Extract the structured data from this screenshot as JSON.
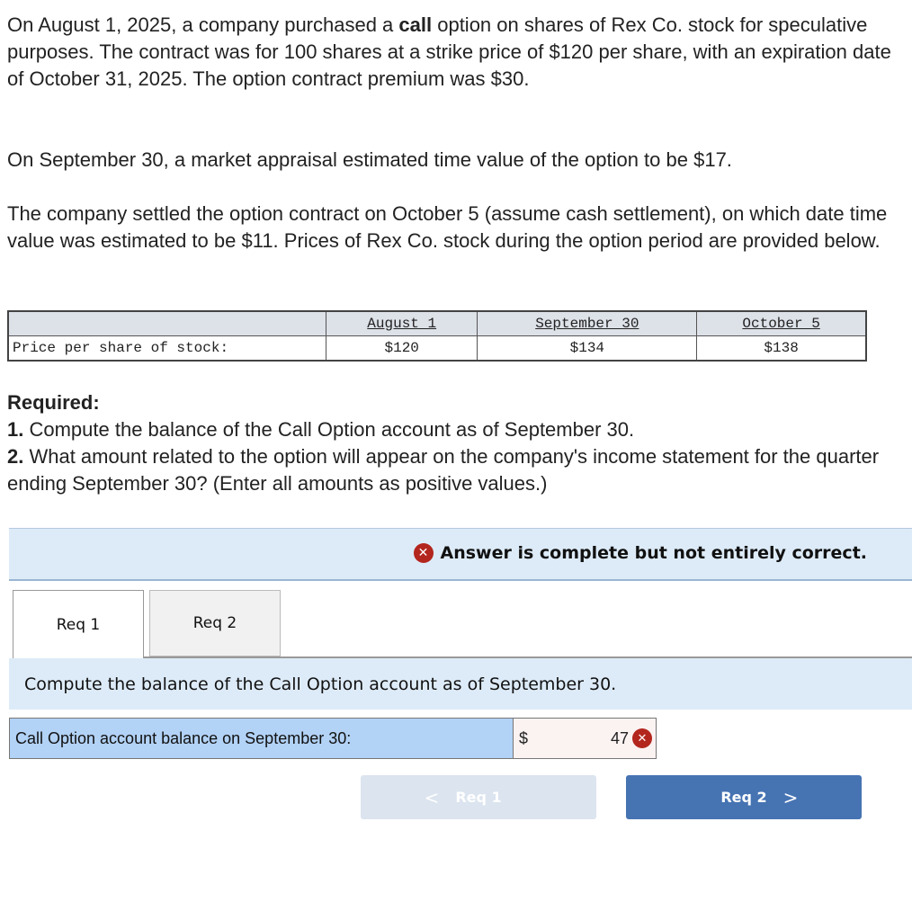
{
  "problem": {
    "intro_before_bold": "On August 1, 2025, a company purchased a ",
    "intro_bold": "call",
    "intro_after_bold": " option on shares of Rex Co. stock for speculative purposes.  The contract was for 100 shares at a strike price of $120 per share, with an expiration date of October 31, 2025.  The option contract premium was $30.",
    "appraisal": "On September 30, a market appraisal estimated time value of the option to be $17.",
    "settlement": "The company settled the option contract on October 5 (assume cash settlement), on which date time value was estimated to be $11.  Prices of Rex Co. stock during the option period are provided below."
  },
  "price_table": {
    "columns": [
      "",
      "August 1",
      "September 30",
      "October 5"
    ],
    "rows": [
      {
        "label": "Price per share of stock:",
        "values": [
          "$120",
          "$134",
          "$138"
        ]
      }
    ]
  },
  "required": {
    "title": "Required:",
    "items": [
      {
        "num": "1.",
        "text": " Compute the balance of the Call Option account as of September 30."
      },
      {
        "num": "2.",
        "text": " What amount related to the option will appear on the company's income statement for the quarter ending September 30? (Enter all amounts as positive values.)"
      }
    ]
  },
  "feedback": {
    "icon": "x-circle-icon",
    "message": "Answer is complete but not entirely correct.",
    "status_color": "#b3261e"
  },
  "tabs": [
    {
      "label": "Req 1",
      "active": true
    },
    {
      "label": "Req 2",
      "active": false
    }
  ],
  "instruction": "Compute the balance of the Call Option account as of September 30.",
  "answer": {
    "label": "Call Option account balance on September 30:",
    "currency": "$",
    "value": "47",
    "correct": false
  },
  "navigation": {
    "prev_label": "Req 1",
    "next_label": "Req 2",
    "prev_chevron": "<",
    "next_chevron": ">",
    "accent_color": "#4673b2"
  }
}
